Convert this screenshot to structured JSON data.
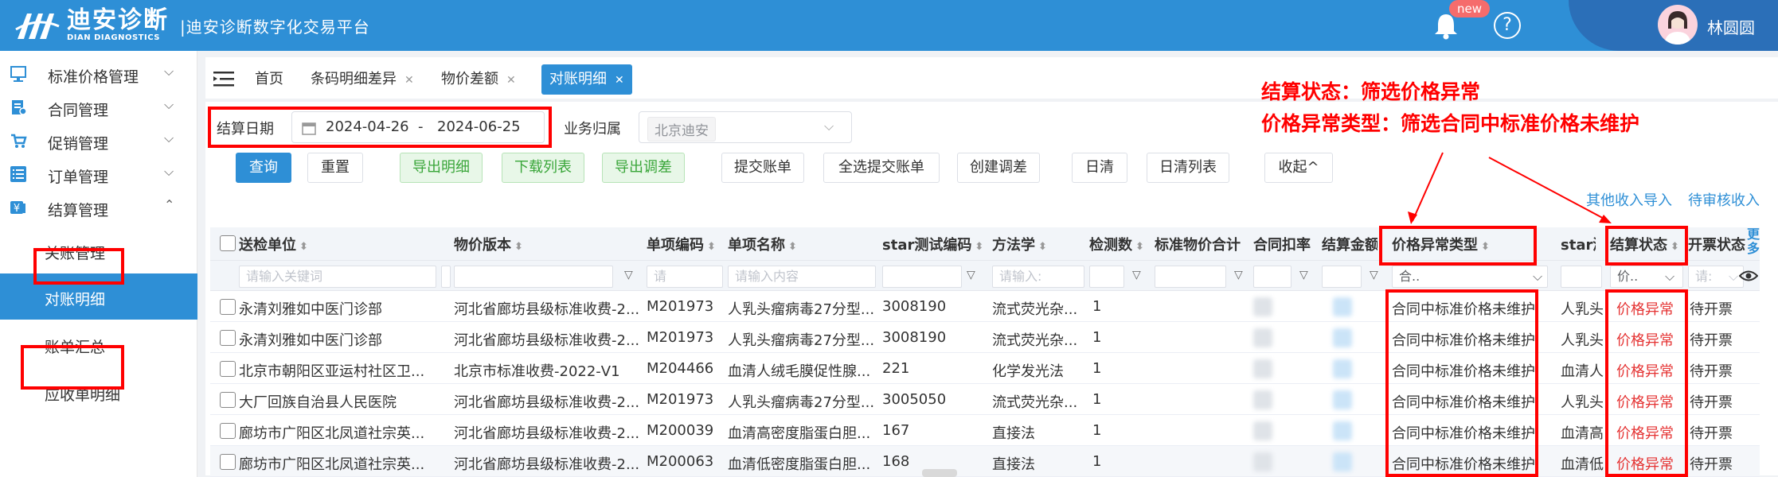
{
  "header": {
    "brand_cn": "迪安诊断",
    "brand_en": "DIAN DIAGNOSTICS",
    "platform": "|迪安诊断数字化交易平台",
    "badge": "new",
    "help": "?",
    "username": "林圆圆"
  },
  "sidebar": {
    "items": [
      {
        "label": "标准价格管理"
      },
      {
        "label": "合同管理"
      },
      {
        "label": "促销管理"
      },
      {
        "label": "订单管理"
      },
      {
        "label": "结算管理"
      }
    ],
    "subitems": [
      {
        "label": "关账管理"
      },
      {
        "label": "对账明细"
      },
      {
        "label": "账单汇总"
      },
      {
        "label": "应收单明细"
      }
    ]
  },
  "tabs": [
    {
      "label": "首页"
    },
    {
      "label": "条码明细差异"
    },
    {
      "label": "物价差额"
    },
    {
      "label": "对账明细"
    }
  ],
  "filters": {
    "date_label": "结算日期",
    "date_start": "2024-04-26",
    "date_sep": "-",
    "date_end": "2024-06-25",
    "owner_label": "业务归属",
    "owner_value": "北京迪安"
  },
  "buttons": {
    "query": "查询",
    "reset": "重置",
    "export_detail": "导出明细",
    "download_list": "下载列表",
    "export_adjust": "导出调差",
    "submit_bill": "提交账单",
    "select_all_submit": "全选提交账单",
    "create_adjust": "创建调差",
    "daily_clear": "日清",
    "daily_clear_list": "日清列表",
    "collapse": "收起^"
  },
  "links": {
    "other_income": "其他收入导入",
    "pending_income": "待审核收入"
  },
  "table": {
    "columns": [
      "送检单位",
      "物价版本",
      "单项编码",
      "单项名称",
      "star测试编码",
      "方法学",
      "检测数",
      "标准物价合计",
      "合同扣率",
      "结算金额",
      "价格异常类型",
      "star测",
      "结算状态",
      "开票状态"
    ],
    "more": "更多",
    "filter_placeholders": {
      "unit": "请输入关键词",
      "code": "请",
      "name": "请输入内容",
      "method": "请输入:",
      "anomaly": "合..",
      "status": "价..",
      "invoice": "请:"
    },
    "rows": [
      {
        "unit": "永清刘雅如中医门诊部",
        "version": "河北省廊坊县级标准收费-2...",
        "code": "M201973",
        "name": "人乳头瘤病毒27分型...",
        "star": "3008190",
        "method": "流式荧光杂...",
        "count": "1",
        "anomaly": "合同中标准价格未维护",
        "star2": "人乳头",
        "status": "价格异常",
        "invoice": "待开票"
      },
      {
        "unit": "永清刘雅如中医门诊部",
        "version": "河北省廊坊县级标准收费-2...",
        "code": "M201973",
        "name": "人乳头瘤病毒27分型...",
        "star": "3008190",
        "method": "流式荧光杂...",
        "count": "1",
        "anomaly": "合同中标准价格未维护",
        "star2": "人乳头",
        "status": "价格异常",
        "invoice": "待开票"
      },
      {
        "unit": "北京市朝阳区亚运村社区卫...",
        "version": "北京市标准收费-2022-V1",
        "code": "M204466",
        "name": "血清人绒毛膜促性腺...",
        "star": "221",
        "method": "化学发光法",
        "count": "1",
        "anomaly": "合同中标准价格未维护",
        "star2": "血清人",
        "status": "价格异常",
        "invoice": "待开票"
      },
      {
        "unit": "大厂回族自治县人民医院",
        "version": "河北省廊坊县级标准收费-2...",
        "code": "M201973",
        "name": "人乳头瘤病毒27分型...",
        "star": "3005050",
        "method": "流式荧光杂...",
        "count": "1",
        "anomaly": "合同中标准价格未维护",
        "star2": "人乳头",
        "status": "价格异常",
        "invoice": "待开票"
      },
      {
        "unit": "廊坊市广阳区北凤道社宗英...",
        "version": "河北省廊坊县级标准收费-2...",
        "code": "M200039",
        "name": "血清高密度脂蛋白胆...",
        "star": "167",
        "method": "直接法",
        "count": "1",
        "anomaly": "合同中标准价格未维护",
        "star2": "血清高",
        "status": "价格异常",
        "invoice": "待开票"
      },
      {
        "unit": "廊坊市广阳区北凤道社宗英...",
        "version": "河北省廊坊县级标准收费-2...",
        "code": "M200063",
        "name": "血清低密度脂蛋白胆...",
        "star": "168",
        "method": "直接法",
        "count": "1",
        "anomaly": "合同中标准价格未维护",
        "star2": "血清低",
        "status": "价格异常",
        "invoice": "待开票"
      }
    ]
  },
  "annotations": {
    "line1": "结算状态：筛选价格异常",
    "line2": "价格异常类型：筛选合同中标准价格未维护"
  },
  "colors": {
    "primary": "#2e8fd6",
    "header_dark": "#2b6fb8",
    "annotation_red": "#ff0000",
    "status_red": "#e53333"
  }
}
